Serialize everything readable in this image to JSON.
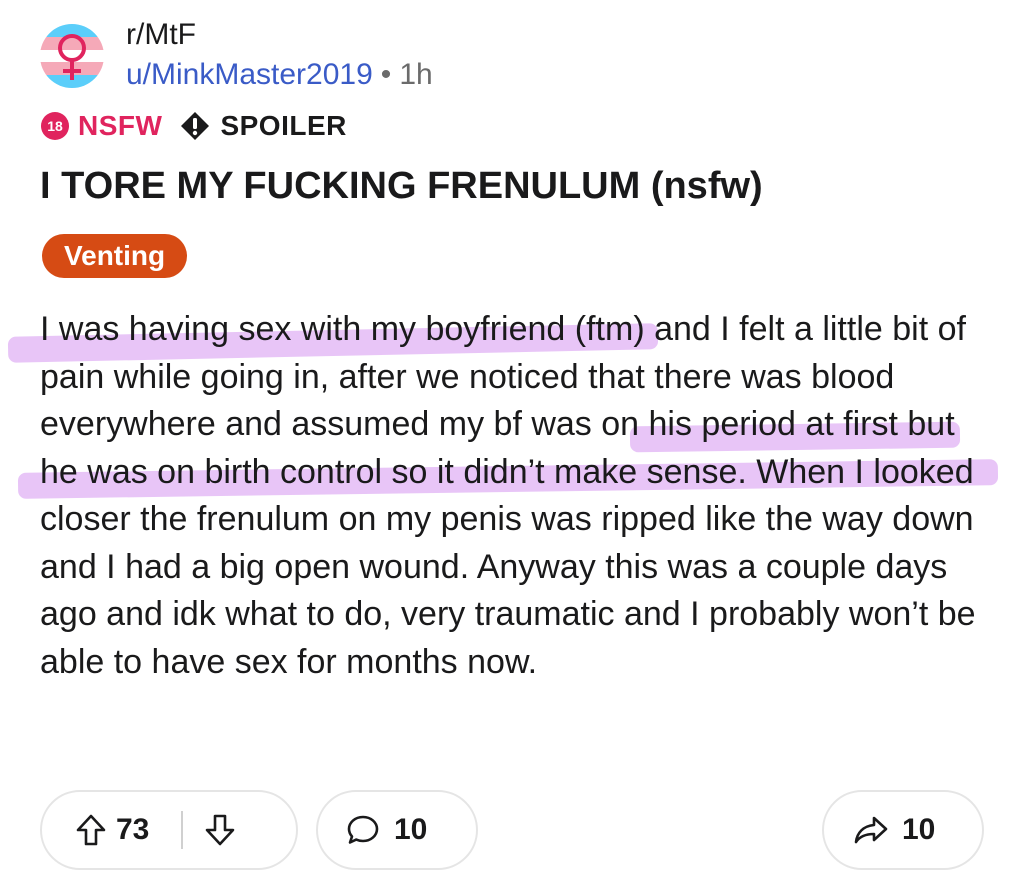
{
  "post": {
    "subreddit": "r/MtF",
    "author": "u/MinkMaster2019",
    "separator": "•",
    "age": "1h",
    "nsfw_badge_number": "18",
    "nsfw_label": "NSFW",
    "spoiler_label": "SPOILER",
    "title": "I TORE MY FUCKING FRENULUM (nsfw)",
    "flair": "Venting",
    "body": "I was having sex with my boyfriend (ftm) and I felt a little bit of pain while going in, after we noticed that there was blood everywhere and assumed my bf was on his period at first but he was on birth control so it didn’t make sense. When I looked closer the frenulum on my penis was ripped like the way down and I had a big open wound. Anyway this was a couple days ago and idk what to do, very traumatic and I probably won’t be able to have sex for months now."
  },
  "actions": {
    "upvotes": "73",
    "comments": "10",
    "shares": "10"
  },
  "icons": {
    "avatar": "trans-flag-venus-icon",
    "nsfw": "nsfw-18-icon",
    "spoiler": "spoiler-alert-icon",
    "upvote": "upvote-arrow-icon",
    "downvote": "downvote-arrow-icon",
    "comment": "comment-bubble-icon",
    "share": "share-arrow-icon"
  },
  "colors": {
    "nsfw": "#e0245e",
    "flair_bg": "#d64b14",
    "author_link": "#3a5bc7",
    "highlight": "#d696f0",
    "trans_blue": "#5bcefa",
    "trans_pink": "#f5a9b8"
  }
}
